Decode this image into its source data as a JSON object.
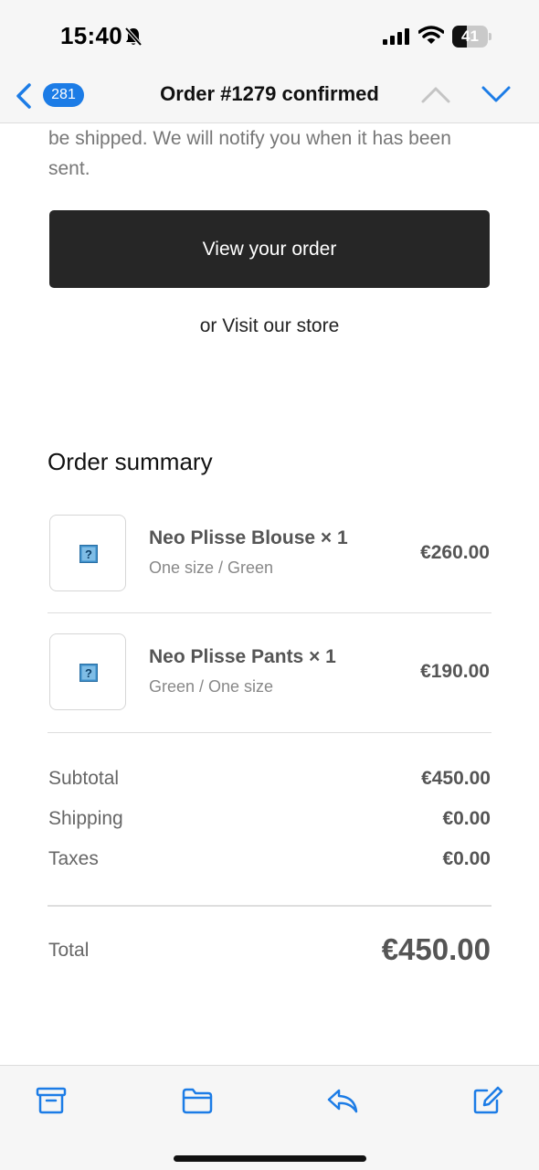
{
  "status_bar": {
    "time": "15:40",
    "battery": {
      "level": 41,
      "label": "41"
    }
  },
  "nav": {
    "unread_count": "281",
    "title": "Order #1279 confirmed"
  },
  "email": {
    "intro_text": "be shipped. We will notify you when it has been sent.",
    "view_order_label": "View your order",
    "visit_store_prefix": "or ",
    "visit_store_link": "Visit our store",
    "summary_title": "Order summary",
    "items": [
      {
        "name": "Neo Plisse Blouse × 1",
        "variant": "One size / Green",
        "price": "€260.00"
      },
      {
        "name": "Neo Plisse Pants × 1",
        "variant": "Green / One size",
        "price": "€190.00"
      }
    ],
    "costs": [
      {
        "label": "Subtotal",
        "value": "€450.00"
      },
      {
        "label": "Shipping",
        "value": "€0.00"
      },
      {
        "label": "Taxes",
        "value": "€0.00"
      }
    ],
    "total_label": "Total",
    "total_value": "€450.00"
  },
  "colors": {
    "accent": "#1c7ce6",
    "button_bg": "#262626"
  },
  "toolbar": {
    "icons": [
      "archive-icon",
      "folder-icon",
      "reply-icon",
      "compose-icon"
    ]
  }
}
